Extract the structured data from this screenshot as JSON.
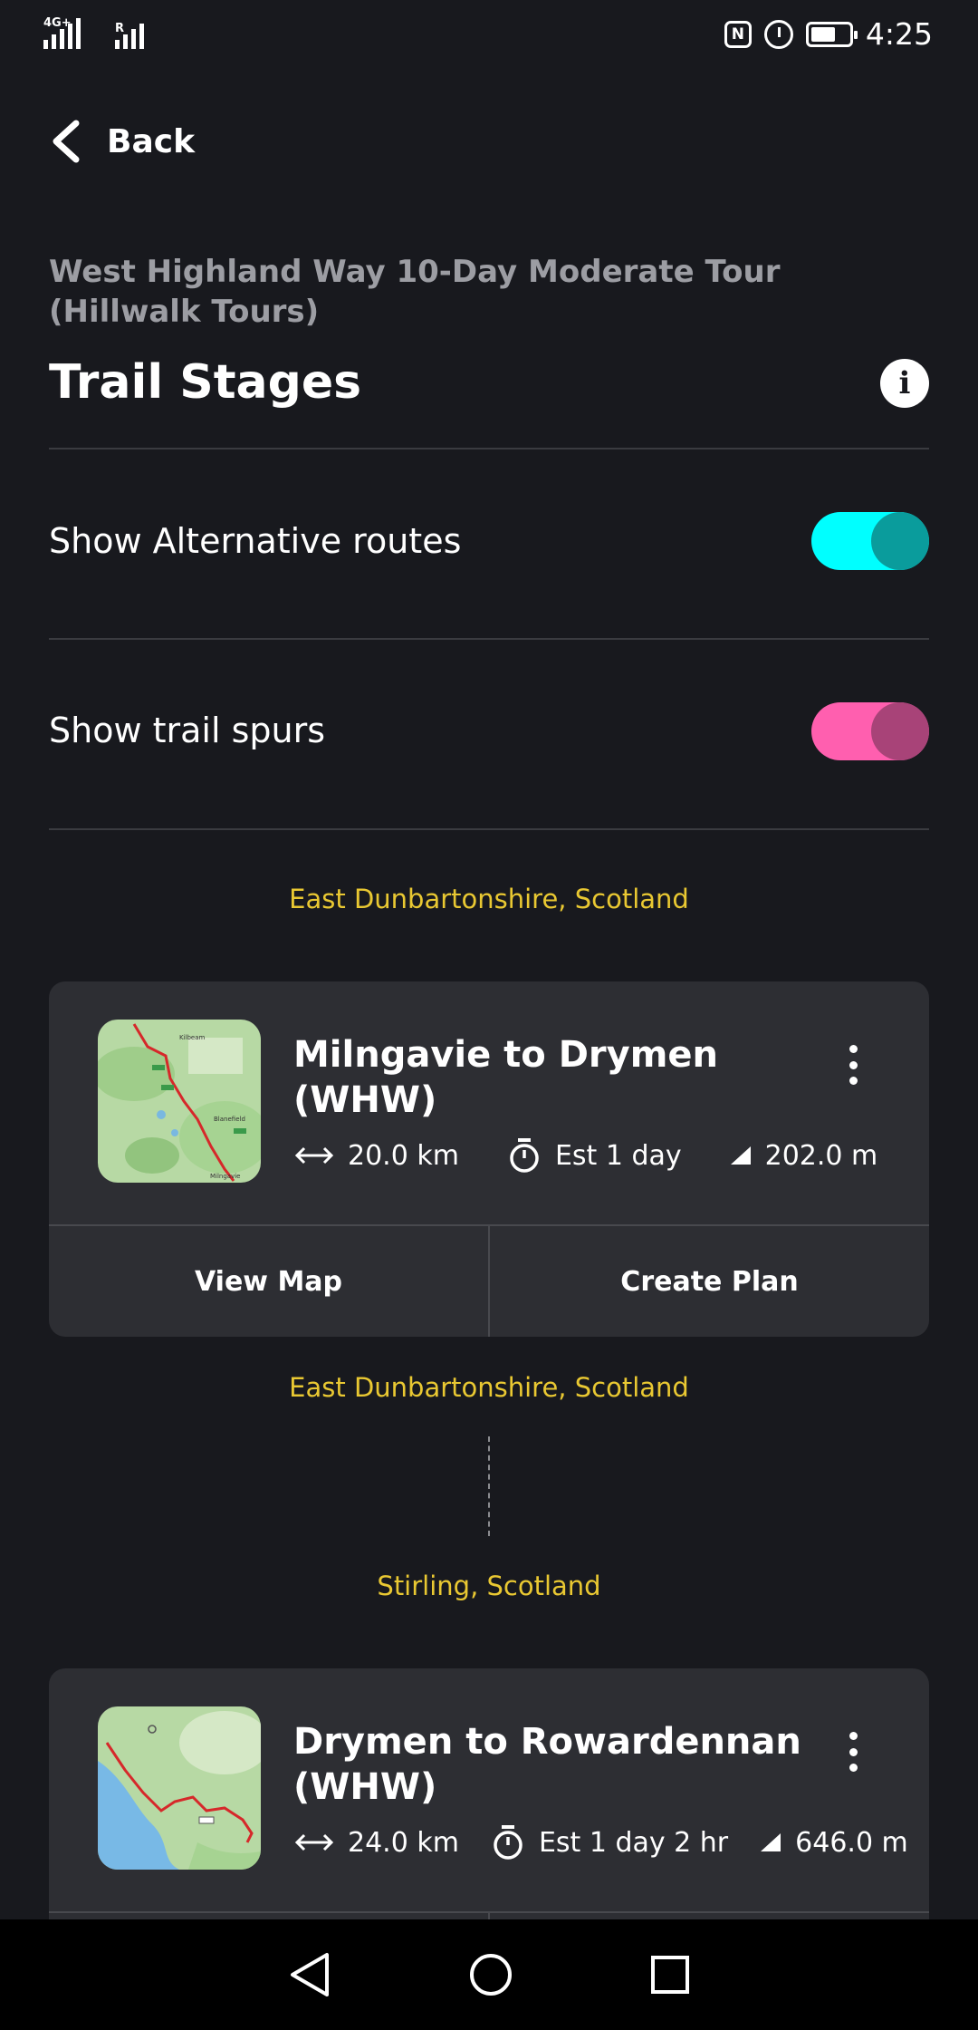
{
  "status_bar": {
    "network_label": "4G+",
    "roaming_label": "R",
    "nfc_label": "N",
    "time": "4:25"
  },
  "header": {
    "back_label": "Back",
    "subtitle": "West Highland Way 10-Day Moderate Tour (Hillwalk Tours)",
    "title": "Trail Stages",
    "info_label": "i"
  },
  "settings": {
    "alternative_routes": {
      "label": "Show Alternative routes",
      "on": true,
      "color": "#00ffff",
      "knob_color": "#0a9c9c"
    },
    "trail_spurs": {
      "label": "Show trail spurs",
      "on": true,
      "color": "#ff5faf",
      "knob_color": "#a84378"
    }
  },
  "regions": {
    "r1": "East Dunbartonshire, Scotland",
    "r2": "East Dunbartonshire, Scotland",
    "r3": "Stirling, Scotland"
  },
  "stages": [
    {
      "title": "Milngavie to Drymen (WHW)",
      "distance": "20.0 km",
      "duration": "Est 1 day",
      "elevation": "202.0 m",
      "view_map_label": "View Map",
      "create_plan_label": "Create Plan",
      "map_labels": [
        "Kilbeam",
        "Blanefield",
        "Milngavie"
      ]
    },
    {
      "title": "Drymen to Rowardennan (WHW)",
      "distance": "24.0 km",
      "duration": "Est 1 day 2 hr",
      "elevation": "646.0 m"
    }
  ],
  "icons": {
    "back": "chevron-left-icon",
    "info": "info-icon",
    "distance": "double-arrow-icon",
    "duration": "stopwatch-icon",
    "elevation": "elevation-triangle-icon",
    "menu": "kebab-menu-icon",
    "nav_back": "triangle-back-icon",
    "nav_home": "circle-home-icon",
    "nav_recents": "square-recents-icon"
  }
}
